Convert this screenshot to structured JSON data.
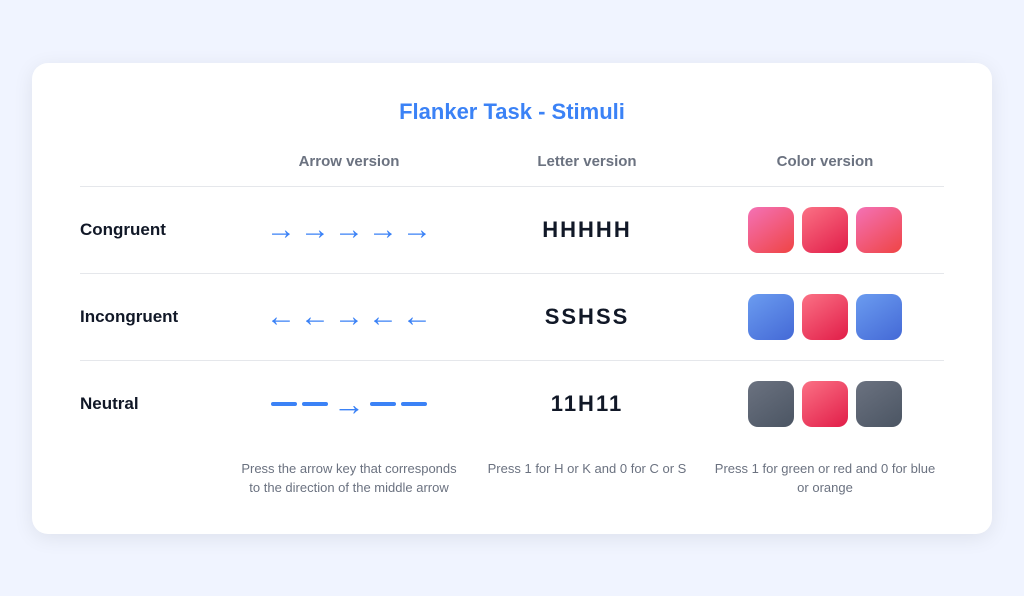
{
  "title": "Flanker Task - Stimuli",
  "headers": {
    "label_col": "",
    "arrow_col": "Arrow version",
    "letter_col": "Letter version",
    "color_col": "Color version"
  },
  "rows": {
    "congruent": {
      "label": "Congruent",
      "letter": "HHHHH",
      "instruction_arrow": "Press the arrow key that corresponds to the direction of the middle arrow",
      "instruction_letter": "Press 1 for H or K and 0 for C or S",
      "instruction_color": "Press 1 for green or red and 0 for blue or orange"
    },
    "incongruent": {
      "label": "Incongruent",
      "letter": "SSHSS"
    },
    "neutral": {
      "label": "Neutral",
      "letter": "11H11"
    }
  }
}
